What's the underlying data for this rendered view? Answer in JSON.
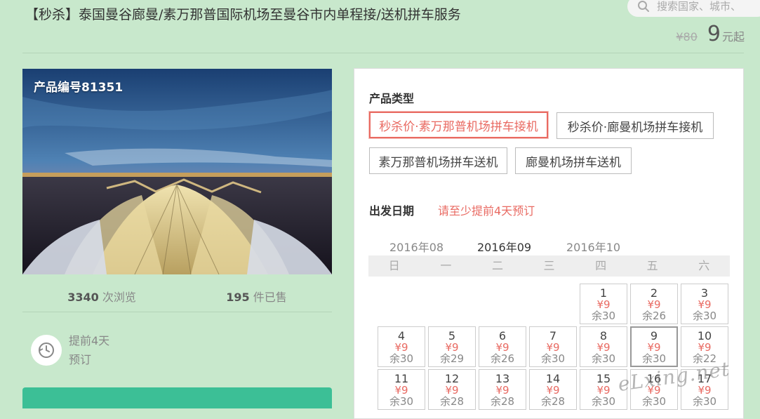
{
  "header": {
    "title": "【秒杀】泰国曼谷廊曼/素万那普国际机场至曼谷市内单程接/送机拼车服务",
    "search_placeholder": "搜索国家、城市、",
    "old_price": "¥80",
    "price": "9",
    "price_unit": "元起"
  },
  "product": {
    "code": "产品编号81351",
    "views_count": "3340",
    "views_label": "次浏览",
    "sold_count": "195",
    "sold_label": "件已售",
    "advance_line1": "提前4天",
    "advance_line2": "预订"
  },
  "booking": {
    "type_label": "产品类型",
    "types": [
      "秒杀价·素万那普机场拼车接机",
      "秒杀价·廊曼机场拼车接机",
      "素万那普机场拼车送机",
      "廊曼机场拼车送机"
    ],
    "date_label": "出发日期",
    "date_hint": "请至少提前4天预订",
    "months": [
      "2016年08",
      "2016年09",
      "2016年10"
    ],
    "weekdays": [
      "日",
      "一",
      "二",
      "三",
      "四",
      "五",
      "六"
    ],
    "days": [
      {
        "d": "1",
        "p": "¥9",
        "r": "余30"
      },
      {
        "d": "2",
        "p": "¥9",
        "r": "余26"
      },
      {
        "d": "3",
        "p": "¥9",
        "r": "余30"
      },
      {
        "d": "4",
        "p": "¥9",
        "r": "余30"
      },
      {
        "d": "5",
        "p": "¥9",
        "r": "余29"
      },
      {
        "d": "6",
        "p": "¥9",
        "r": "余26"
      },
      {
        "d": "7",
        "p": "¥9",
        "r": "余30"
      },
      {
        "d": "8",
        "p": "¥9",
        "r": "余30"
      },
      {
        "d": "9",
        "p": "¥9",
        "r": "余30"
      },
      {
        "d": "10",
        "p": "¥9",
        "r": "余22"
      },
      {
        "d": "11",
        "p": "¥9",
        "r": "余30"
      },
      {
        "d": "12",
        "p": "¥9",
        "r": "余28"
      },
      {
        "d": "13",
        "p": "¥9",
        "r": "余28"
      },
      {
        "d": "14",
        "p": "¥9",
        "r": "余28"
      },
      {
        "d": "15",
        "p": "¥9",
        "r": "余30"
      },
      {
        "d": "16",
        "p": "¥9",
        "r": "余30"
      },
      {
        "d": "17",
        "p": "¥9",
        "r": "余30"
      }
    ]
  },
  "watermark": "eLxing.net",
  "colors": {
    "background": "#c8e8cc",
    "accent": "#e96a62",
    "button": "#3cbf96"
  }
}
